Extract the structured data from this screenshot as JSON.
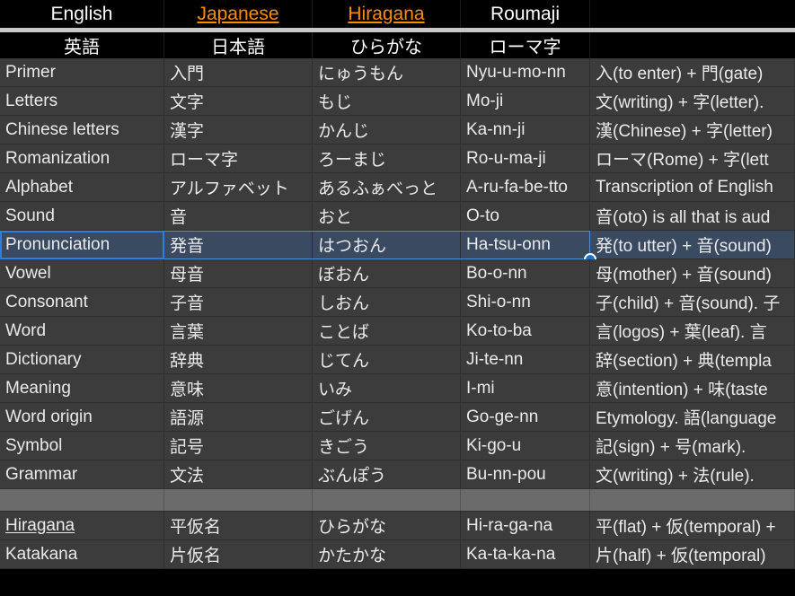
{
  "header": {
    "top_row": [
      {
        "label": "English",
        "style": "plain"
      },
      {
        "label": "Japanese",
        "style": "link"
      },
      {
        "label": "Hiragana",
        "style": "link"
      },
      {
        "label": "Roumaji",
        "style": "plain"
      },
      {
        "label": "",
        "style": "plain"
      }
    ],
    "second_row": [
      {
        "label": "英語"
      },
      {
        "label": "日本語"
      },
      {
        "label": "ひらがな"
      },
      {
        "label": "ローマ字"
      },
      {
        "label": ""
      }
    ]
  },
  "colors": {
    "page_background": "#000000",
    "grid_background": "#3c3c3c",
    "grid_line": "#2e2e2e",
    "text": "#eaeaea",
    "header_link": "#ff8c00",
    "header_separator": "#c8c8c8",
    "selection_fill": "#3a4a60",
    "selection_border": "#2a7fe0",
    "selection_handle": "#1a6fd4",
    "spacer_row": "#6b6b6b"
  },
  "selection": {
    "row_index": 6,
    "anchor_column": 0,
    "range_columns": 4,
    "handle": "selection-fill-handle"
  },
  "rows": [
    {
      "english": "Primer",
      "japanese": "入門",
      "hiragana": "にゅうもん",
      "roumaji": "Nyu-u-mo-nn",
      "notes": "入(to enter) + 門(gate)",
      "english_link": false,
      "spacer": false
    },
    {
      "english": "Letters",
      "japanese": "文字",
      "hiragana": "もじ",
      "roumaji": "Mo-ji",
      "notes": "文(writing) + 字(letter).",
      "english_link": false,
      "spacer": false
    },
    {
      "english": "Chinese letters",
      "japanese": "漢字",
      "hiragana": "かんじ",
      "roumaji": "Ka-nn-ji",
      "notes": "漢(Chinese) + 字(letter)",
      "english_link": false,
      "spacer": false
    },
    {
      "english": "Romanization",
      "japanese": "ローマ字",
      "hiragana": "ろーまじ",
      "roumaji": "Ro-u-ma-ji",
      "notes": "ローマ(Rome) + 字(lett",
      "english_link": false,
      "spacer": false
    },
    {
      "english": "Alphabet",
      "japanese": "アルファベット",
      "hiragana": "あるふぁべっと",
      "roumaji": "A-ru-fa-be-tto",
      "notes": "Transcription of English",
      "english_link": false,
      "spacer": false
    },
    {
      "english": "Sound",
      "japanese": "音",
      "hiragana": "おと",
      "roumaji": "O-to",
      "notes": "音(oto) is all that is aud",
      "english_link": false,
      "spacer": false
    },
    {
      "english": "Pronunciation",
      "japanese": "発音",
      "hiragana": "はつおん",
      "roumaji": "Ha-tsu-onn",
      "notes": "発(to utter) + 音(sound)",
      "english_link": false,
      "spacer": false
    },
    {
      "english": "Vowel",
      "japanese": "母音",
      "hiragana": "ぼおん",
      "roumaji": "Bo-o-nn",
      "notes": "母(mother) + 音(sound)",
      "english_link": false,
      "spacer": false
    },
    {
      "english": "Consonant",
      "japanese": "子音",
      "hiragana": "しおん",
      "roumaji": "Shi-o-nn",
      "notes": "子(child) + 音(sound). 子",
      "english_link": false,
      "spacer": false
    },
    {
      "english": "Word",
      "japanese": "言葉",
      "hiragana": "ことば",
      "roumaji": "Ko-to-ba",
      "notes": "言(logos) + 葉(leaf).  言",
      "english_link": false,
      "spacer": false
    },
    {
      "english": "Dictionary",
      "japanese": "辞典",
      "hiragana": "じてん",
      "roumaji": "Ji-te-nn",
      "notes": "辞(section) + 典(templa",
      "english_link": false,
      "spacer": false
    },
    {
      "english": "Meaning",
      "japanese": "意味",
      "hiragana": "いみ",
      "roumaji": "I-mi",
      "notes": "意(intention) + 味(taste",
      "english_link": false,
      "spacer": false
    },
    {
      "english": "Word origin",
      "japanese": "語源",
      "hiragana": "ごげん",
      "roumaji": "Go-ge-nn",
      "notes": "Etymology. 語(language",
      "english_link": false,
      "spacer": false
    },
    {
      "english": "Symbol",
      "japanese": "記号",
      "hiragana": "きごう",
      "roumaji": "Ki-go-u",
      "notes": "記(sign) + 号(mark).",
      "english_link": false,
      "spacer": false
    },
    {
      "english": "Grammar",
      "japanese": "文法",
      "hiragana": "ぶんぽう",
      "roumaji": "Bu-nn-pou",
      "notes": "文(writing) + 法(rule).",
      "english_link": false,
      "spacer": false
    },
    {
      "english": "",
      "japanese": "",
      "hiragana": "",
      "roumaji": "",
      "notes": "",
      "english_link": false,
      "spacer": true
    },
    {
      "english": "Hiragana",
      "japanese": "平仮名",
      "hiragana": "ひらがな",
      "roumaji": "Hi-ra-ga-na",
      "notes": "平(flat) + 仮(temporal) +",
      "english_link": true,
      "spacer": false
    },
    {
      "english": "Katakana",
      "japanese": "片仮名",
      "hiragana": "かたかな",
      "roumaji": "Ka-ta-ka-na",
      "notes": "片(half) + 仮(temporal)",
      "english_link": false,
      "spacer": false
    }
  ]
}
